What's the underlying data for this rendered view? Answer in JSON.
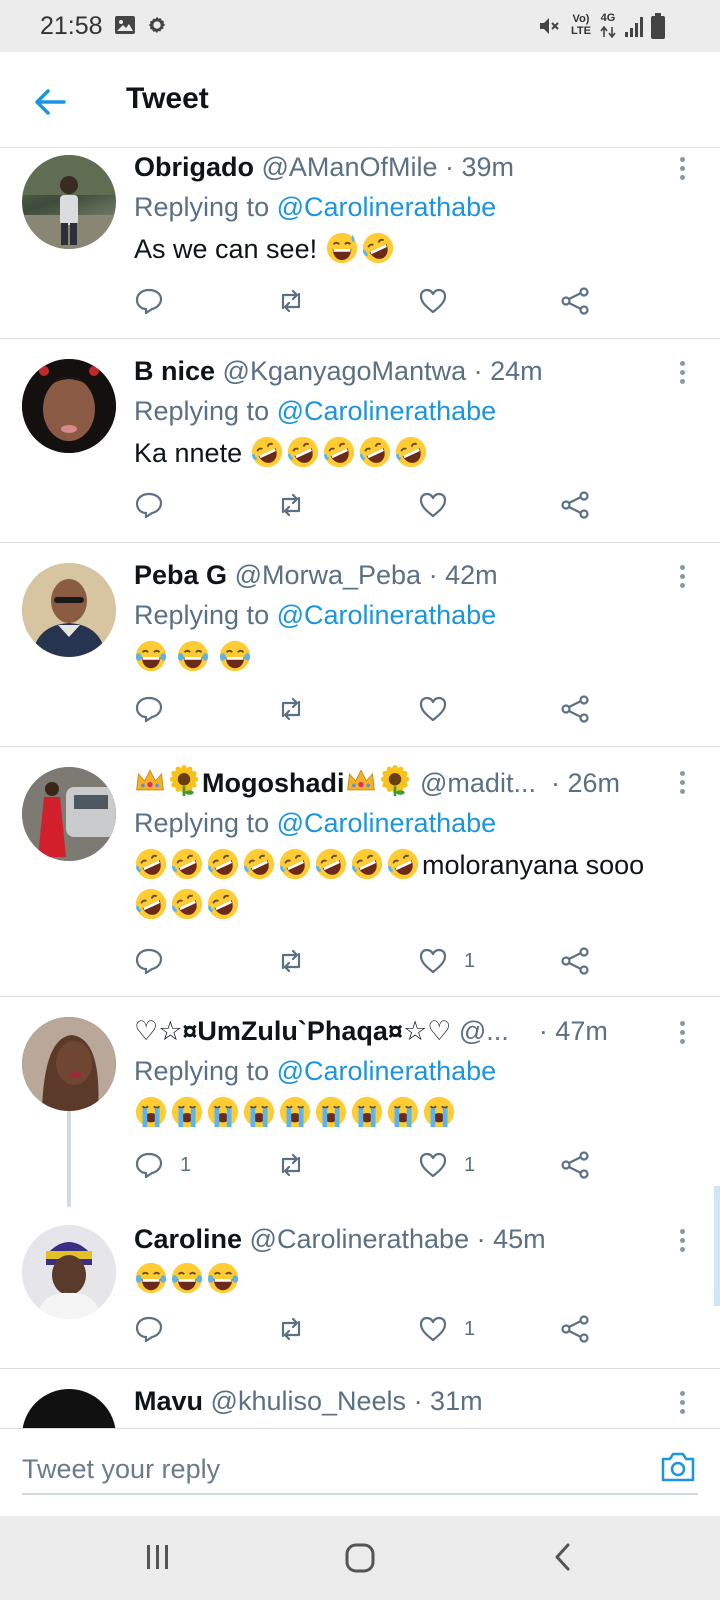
{
  "status_bar": {
    "time": "21:58",
    "icons": [
      "gallery-icon",
      "settings-icon",
      "mute-icon",
      "volte-icon",
      "4g-icon",
      "signal-icon",
      "battery-icon"
    ],
    "volte_label_top": "Vo)",
    "volte_label_bottom": "LTE",
    "network_label": "4G"
  },
  "header": {
    "title": "Tweet",
    "back_icon": "arrow-left-icon",
    "accent": "#1b95e0"
  },
  "tweets": [
    {
      "name": "Obrigado",
      "handle": "@AManOfMile",
      "time": "· 39m",
      "replying_prefix": "Replying to",
      "replying_to": "@Carolinerathabe",
      "text": "As we can see!",
      "emojis": [
        "grin-sweat",
        "rofl"
      ],
      "replies": "",
      "likes": ""
    },
    {
      "name": "B nice",
      "handle": "@KganyagoMantwa",
      "time": "· 24m",
      "replying_prefix": "Replying to",
      "replying_to": "@Carolinerathabe",
      "text": "Ka nnete",
      "emojis": [
        "rofl",
        "rofl",
        "rofl",
        "rofl",
        "rofl"
      ],
      "replies": "",
      "likes": ""
    },
    {
      "name": "Peba G",
      "handle": "@Morwa_Peba",
      "time": "· 42m",
      "replying_prefix": "Replying to",
      "replying_to": "@Carolinerathabe",
      "text": "",
      "emojis": [
        "joy",
        "joy",
        "joy"
      ],
      "replies": "",
      "likes": ""
    },
    {
      "name": "Mogoshadi",
      "handle": "@madit...",
      "time": "· 26m",
      "replying_prefix": "Replying to",
      "replying_to": "@Carolinerathabe",
      "text": "moloranyana sooo",
      "emojis": [
        "rofl",
        "rofl",
        "rofl",
        "rofl",
        "rofl",
        "rofl",
        "rofl",
        "rofl"
      ],
      "emojis_line2": [
        "rofl",
        "rofl",
        "rofl"
      ],
      "replies": "",
      "likes": "1"
    },
    {
      "name": "♡☆¤UmZulu`Phaqa¤☆♡",
      "handle": "@...",
      "time": "· 47m",
      "replying_prefix": "Replying to",
      "replying_to": "@Carolinerathabe",
      "text": "",
      "emojis": [
        "sob",
        "sob",
        "sob",
        "sob",
        "sob",
        "sob",
        "sob",
        "sob",
        "sob"
      ],
      "replies": "1",
      "likes": "1"
    },
    {
      "name": "Caroline",
      "handle": "@Carolinerathabe",
      "time": "· 45m",
      "text": "",
      "emojis": [
        "joy",
        "joy",
        "joy"
      ],
      "replies": "",
      "likes": "1"
    },
    {
      "name": "Mavu",
      "handle": "@khuliso_Neels",
      "time": "· 31m"
    }
  ],
  "reply_bar": {
    "placeholder": "Tweet your reply",
    "camera_icon": "camera-icon"
  },
  "nav_bar": {
    "icons": [
      "recents-icon",
      "home-icon",
      "back-icon"
    ]
  }
}
